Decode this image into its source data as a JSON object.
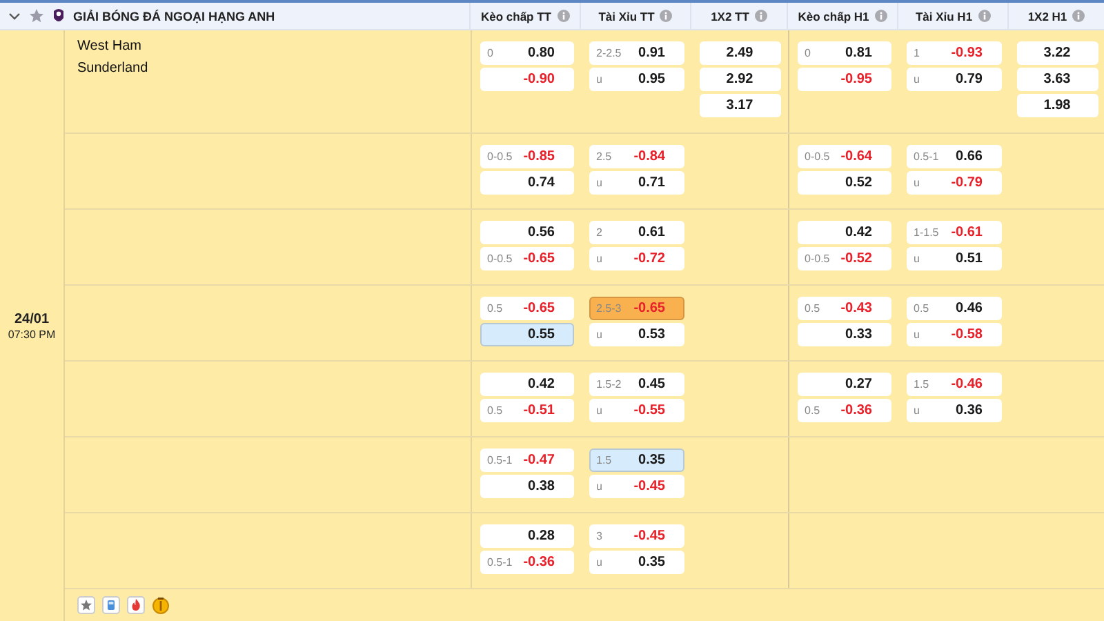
{
  "league": {
    "name": "GIẢI BÓNG ĐÁ NGOẠI HẠNG ANH"
  },
  "columns": [
    "Kèo chấp TT",
    "Tài Xỉu TT",
    "1X2 TT",
    "Kèo chấp H1",
    "Tài Xỉu H1",
    "1X2 H1"
  ],
  "match": {
    "date": "24/01",
    "time": "07:30 PM",
    "teams": [
      "West Ham",
      "Sunderland"
    ]
  },
  "rows": [
    {
      "kc_tt": [
        {
          "line": "0",
          "value": "0.80",
          "negative": false
        },
        {
          "value": "-0.90",
          "negative": true
        }
      ],
      "tx_tt": [
        {
          "line": "2-2.5",
          "value": "0.91",
          "negative": false
        },
        {
          "line": "u",
          "value": "0.95",
          "negative": false
        }
      ],
      "x12_tt": [
        {
          "value": "2.49",
          "negative": false
        },
        {
          "value": "2.92",
          "negative": false
        },
        {
          "value": "3.17",
          "negative": false
        }
      ],
      "kc_h1": [
        {
          "line": "0",
          "value": "0.81",
          "negative": false
        },
        {
          "value": "-0.95",
          "negative": true
        }
      ],
      "tx_h1": [
        {
          "line": "1",
          "value": "-0.93",
          "negative": true
        },
        {
          "line": "u",
          "value": "0.79",
          "negative": false
        }
      ],
      "x12_h1": [
        {
          "value": "3.22",
          "negative": false
        },
        {
          "value": "3.63",
          "negative": false
        },
        {
          "value": "1.98",
          "negative": false
        }
      ]
    },
    {
      "kc_tt": [
        {
          "line": "0-0.5",
          "value": "-0.85",
          "negative": true
        },
        {
          "value": "0.74",
          "negative": false
        }
      ],
      "tx_tt": [
        {
          "line": "2.5",
          "value": "-0.84",
          "negative": true
        },
        {
          "line": "u",
          "value": "0.71",
          "negative": false
        }
      ],
      "kc_h1": [
        {
          "line": "0-0.5",
          "value": "-0.64",
          "negative": true
        },
        {
          "value": "0.52",
          "negative": false
        }
      ],
      "tx_h1": [
        {
          "line": "0.5-1",
          "value": "0.66",
          "negative": false
        },
        {
          "line": "u",
          "value": "-0.79",
          "negative": true
        }
      ]
    },
    {
      "kc_tt": [
        {
          "value": "0.56",
          "negative": false
        },
        {
          "line": "0-0.5",
          "value": "-0.65",
          "negative": true
        }
      ],
      "tx_tt": [
        {
          "line": "2",
          "value": "0.61",
          "negative": false
        },
        {
          "line": "u",
          "value": "-0.72",
          "negative": true
        }
      ],
      "kc_h1": [
        {
          "value": "0.42",
          "negative": false
        },
        {
          "line": "0-0.5",
          "value": "-0.52",
          "negative": true
        }
      ],
      "tx_h1": [
        {
          "line": "1-1.5",
          "value": "-0.61",
          "negative": true
        },
        {
          "line": "u",
          "value": "0.51",
          "negative": false
        }
      ]
    },
    {
      "kc_tt": [
        {
          "line": "0.5",
          "value": "-0.65",
          "negative": true
        },
        {
          "value": "0.55",
          "negative": false,
          "color": "#d6ebfb"
        }
      ],
      "tx_tt": [
        {
          "line": "2.5-3",
          "value": "-0.65",
          "negative": true,
          "color": "#f9b14f"
        },
        {
          "line": "u",
          "value": "0.53",
          "negative": false
        }
      ],
      "kc_h1": [
        {
          "line": "0.5",
          "value": "-0.43",
          "negative": true
        },
        {
          "value": "0.33",
          "negative": false
        }
      ],
      "tx_h1": [
        {
          "line": "0.5",
          "value": "0.46",
          "negative": false
        },
        {
          "line": "u",
          "value": "-0.58",
          "negative": true
        }
      ]
    },
    {
      "kc_tt": [
        {
          "value": "0.42",
          "negative": false
        },
        {
          "line": "0.5",
          "value": "-0.51",
          "negative": true
        }
      ],
      "tx_tt": [
        {
          "line": "1.5-2",
          "value": "0.45",
          "negative": false
        },
        {
          "line": "u",
          "value": "-0.55",
          "negative": true
        }
      ],
      "kc_h1": [
        {
          "value": "0.27",
          "negative": false
        },
        {
          "line": "0.5",
          "value": "-0.36",
          "negative": true
        }
      ],
      "tx_h1": [
        {
          "line": "1.5",
          "value": "-0.46",
          "negative": true
        },
        {
          "line": "u",
          "value": "0.36",
          "negative": false
        }
      ]
    },
    {
      "kc_tt": [
        {
          "line": "0.5-1",
          "value": "-0.47",
          "negative": true
        },
        {
          "value": "0.38",
          "negative": false
        }
      ],
      "tx_tt": [
        {
          "line": "1.5",
          "value": "0.35",
          "negative": false,
          "color": "#d6ebfb"
        },
        {
          "line": "u",
          "value": "-0.45",
          "negative": true
        }
      ]
    },
    {
      "kc_tt": [
        {
          "value": "0.28",
          "negative": false
        },
        {
          "line": "0.5-1",
          "value": "-0.36",
          "negative": true
        }
      ],
      "tx_tt": [
        {
          "line": "3",
          "value": "-0.45",
          "negative": true
        },
        {
          "line": "u",
          "value": "0.35",
          "negative": false
        }
      ]
    }
  ]
}
